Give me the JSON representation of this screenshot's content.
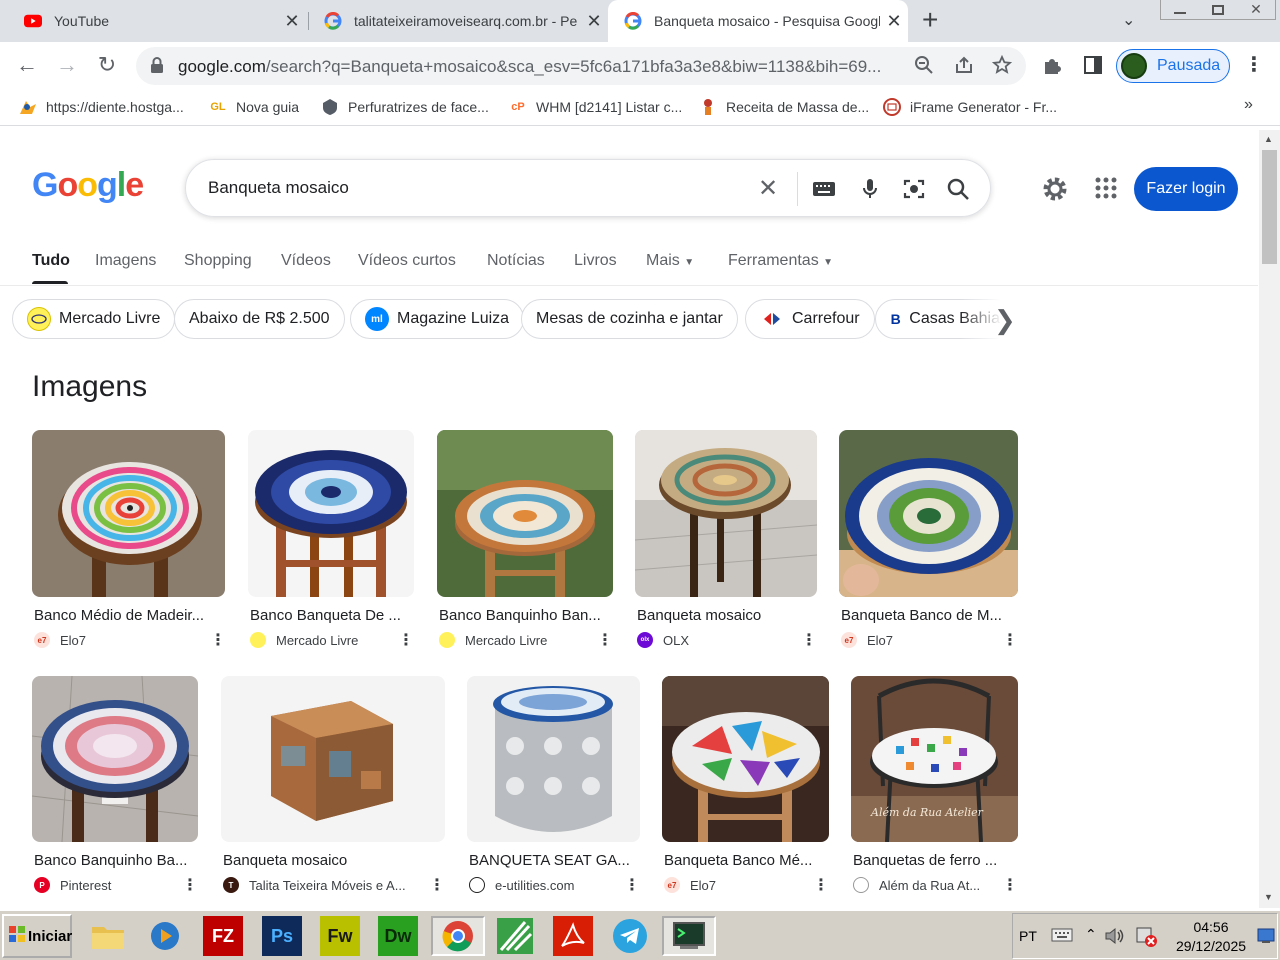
{
  "browser": {
    "tabs": [
      {
        "title": "YouTube",
        "icon": "youtube-icon"
      },
      {
        "title": "talitateixeiramoveisearq.com.br - Pe",
        "icon": "google-icon"
      },
      {
        "title": "Banqueta mosaico - Pesquisa Google",
        "icon": "google-icon",
        "active": true
      }
    ],
    "new_tab": "+",
    "url_main": "google.com",
    "url_rest": "/search?q=Banqueta+mosaico&sca_esv=5fc6a171bfa3a3e8&biw=1138&bih=69...",
    "profile_label": "Pausada"
  },
  "bookmarks": [
    {
      "label": "https://diente.hostga...",
      "icon": "hostgator-icon"
    },
    {
      "label": "Nova guia",
      "icon": "gl-icon",
      "badge": "GL"
    },
    {
      "label": "Perfuratrizes de face...",
      "icon": "shield-icon"
    },
    {
      "label": "WHM [d2141] Listar c...",
      "icon": "cpanel-icon",
      "badge": "cP"
    },
    {
      "label": "Receita de Massa de...",
      "icon": "chef-icon"
    },
    {
      "label": "iFrame Generator - Fr...",
      "icon": "iframe-icon"
    }
  ],
  "bookmarks_more": "»",
  "google": {
    "logo": "Google",
    "query": "Banqueta mosaico",
    "login": "Fazer login",
    "tabs": [
      "Tudo",
      "Imagens",
      "Shopping",
      "Vídeos",
      "Vídeos curtos",
      "Notícias",
      "Livros",
      "Mais",
      "Ferramentas"
    ],
    "chips": [
      {
        "label": "Mercado Livre",
        "icon": "mercadolivre-icon"
      },
      {
        "label": "Abaixo de R$ 2.500",
        "icon": ""
      },
      {
        "label": "Magazine Luiza",
        "icon": "magalu-icon",
        "badge": "ml"
      },
      {
        "label": "Mesas de cozinha e jantar",
        "icon": ""
      },
      {
        "label": "Carrefour",
        "icon": "carrefour-icon"
      },
      {
        "label": "Casas Bahia",
        "icon": "casasbahia-icon",
        "badge": "B"
      }
    ],
    "images_heading": "Imagens",
    "images": [
      {
        "title": "Banco Médio de Madeir...",
        "source": "Elo7",
        "source_icon": "elo7-icon",
        "badge": "e7"
      },
      {
        "title": "Banco Banqueta De ...",
        "source": "Mercado Livre",
        "source_icon": "mercadolivre-icon"
      },
      {
        "title": "Banco Banquinho Ban...",
        "source": "Mercado Livre",
        "source_icon": "mercadolivre-icon"
      },
      {
        "title": "Banqueta mosaico",
        "source": "OLX",
        "source_icon": "olx-icon",
        "badge": "olx"
      },
      {
        "title": "Banqueta Banco de M...",
        "source": "Elo7",
        "source_icon": "elo7-icon",
        "badge": "e7"
      },
      {
        "title": "Banco Banquinho Ba...",
        "source": "Pinterest",
        "source_icon": "pinterest-icon",
        "badge": "P"
      },
      {
        "title": "Banqueta mosaico",
        "source": "Talita Teixeira Móveis e A...",
        "source_icon": "talita-icon",
        "badge": "T"
      },
      {
        "title": "BANQUETA SEAT GA...",
        "source": "e-utilities.com",
        "source_icon": "eutilities-icon"
      },
      {
        "title": "Banqueta Banco Mé...",
        "source": "Elo7",
        "source_icon": "elo7-icon",
        "badge": "e7"
      },
      {
        "title": "Banquetas de ferro ...",
        "source": "Além da Rua At...",
        "source_icon": "alemdarua-icon"
      }
    ],
    "watermark": "Além da Rua Atelier"
  },
  "taskbar": {
    "start": "Iniciar",
    "apps": [
      {
        "icon": "folder-icon",
        "label": ""
      },
      {
        "icon": "media-player-icon",
        "label": ""
      },
      {
        "icon": "filezilla-icon",
        "label": "FZ"
      },
      {
        "icon": "photoshop-icon",
        "label": "Ps"
      },
      {
        "icon": "fireworks-icon",
        "label": "Fw"
      },
      {
        "icon": "dreamweaver-icon",
        "label": "Dw"
      },
      {
        "icon": "chrome-icon",
        "label": ""
      },
      {
        "icon": "app-green-icon",
        "label": ""
      },
      {
        "icon": "acrobat-icon",
        "label": ""
      },
      {
        "icon": "telegram-icon",
        "label": ""
      },
      {
        "icon": "terminal-icon",
        "label": ""
      }
    ],
    "lang": "PT",
    "time": "04:56",
    "date": "29/12/2025"
  }
}
